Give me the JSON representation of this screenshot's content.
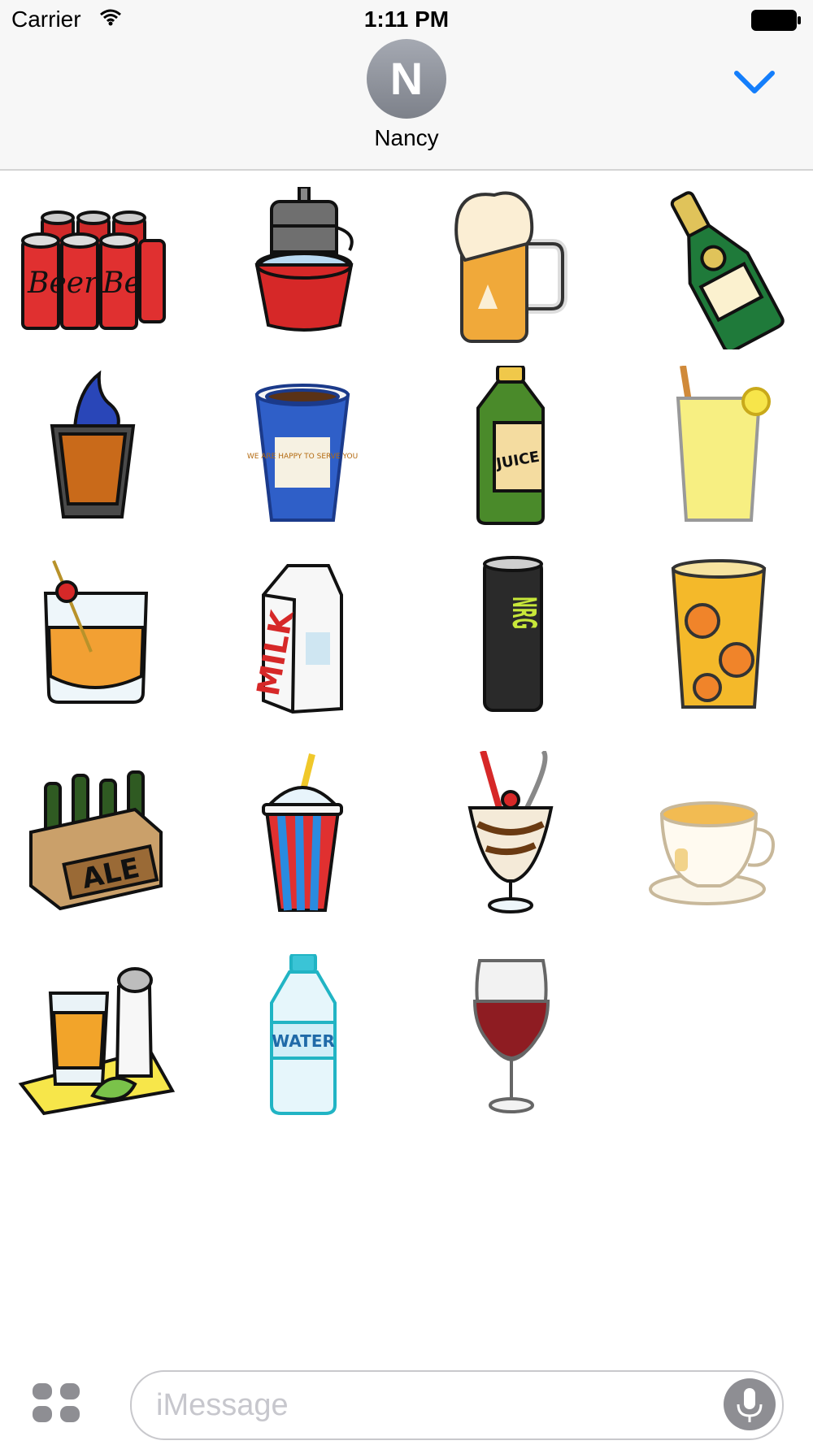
{
  "status": {
    "carrier": "Carrier",
    "time": "1:11 PM"
  },
  "header": {
    "avatar_initial": "N",
    "contact_name": "Nancy"
  },
  "stickers": [
    {
      "name": "beer-six-pack-cans",
      "label": "Beer"
    },
    {
      "name": "beer-keg-ice-bucket"
    },
    {
      "name": "beer-mug"
    },
    {
      "name": "champagne-bottle"
    },
    {
      "name": "flaming-shot"
    },
    {
      "name": "greek-coffee-cup",
      "label": "WE ARE HAPPY TO SERVE YOU"
    },
    {
      "name": "juice-bottle",
      "label": "JUICE"
    },
    {
      "name": "lemonade-glass"
    },
    {
      "name": "old-fashioned-cocktail"
    },
    {
      "name": "milk-carton",
      "label": "MILK"
    },
    {
      "name": "energy-drink-can",
      "label": "NRG"
    },
    {
      "name": "iced-tea-glass"
    },
    {
      "name": "ale-six-pack-crate",
      "label": "ALE"
    },
    {
      "name": "slushie-cup"
    },
    {
      "name": "milkshake-sundae"
    },
    {
      "name": "tea-cup"
    },
    {
      "name": "tequila-shot-salt-lime"
    },
    {
      "name": "water-bottle",
      "label": "WATER"
    },
    {
      "name": "red-wine-glass"
    }
  ],
  "input": {
    "placeholder": "iMessage"
  },
  "icons": {
    "wifi": "wifi-icon",
    "battery": "battery-icon",
    "collapse": "chevron-down-icon",
    "apps": "app-drawer-icon",
    "mic": "microphone-icon"
  },
  "colors": {
    "accent": "#147efb",
    "header_bg": "#f7f7f7"
  }
}
